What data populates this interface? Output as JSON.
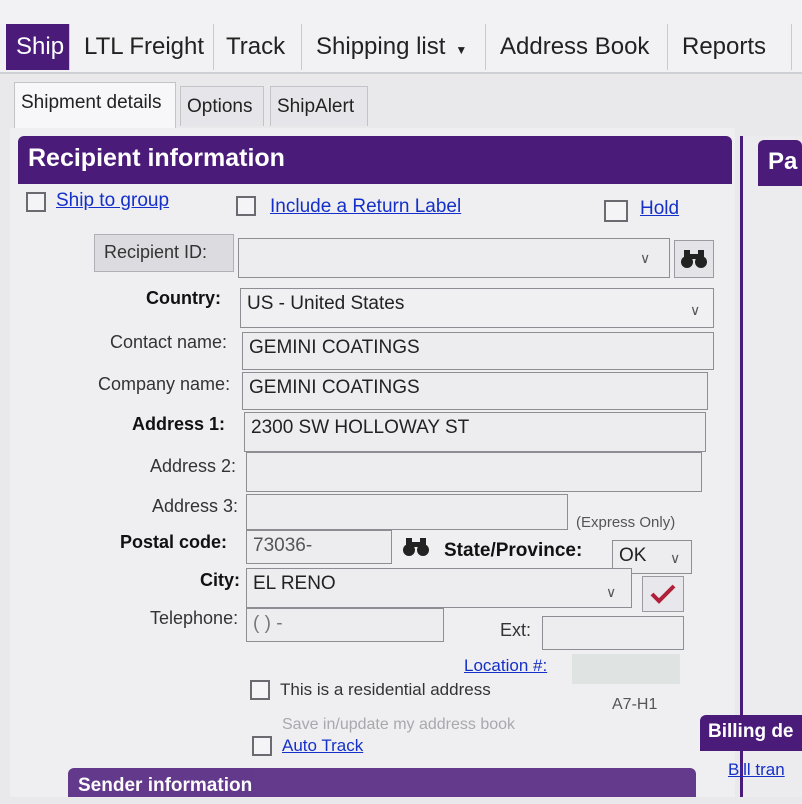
{
  "top_tabs": [
    "Ship",
    "LTL Freight",
    "Track",
    "Shipping list",
    "Address Book",
    "Reports"
  ],
  "sub_tabs": [
    "Shipment details",
    "Options",
    "ShipAlert"
  ],
  "recipient": {
    "header": "Recipient information",
    "ship_to_group": "Ship to group",
    "include_return_label": "Include a Return Label",
    "hold": "Hold",
    "recipient_id_label": "Recipient ID:",
    "recipient_id_value": "",
    "country_label": "Country:",
    "country_value": "US - United States",
    "contact_label": "Contact name:",
    "contact_value": "GEMINI COATINGS",
    "company_label": "Company name:",
    "company_value": "GEMINI COATINGS",
    "address1_label": "Address 1:",
    "address1_value": "2300 SW HOLLOWAY ST",
    "address2_label": "Address 2:",
    "address2_value": "",
    "address3_label": "Address 3:",
    "address3_value": "",
    "express_only": "(Express Only)",
    "postal_label": "Postal code:",
    "postal_value": "73036-",
    "state_label": "State/Province:",
    "state_value": "OK",
    "city_label": "City:",
    "city_value": "EL RENO",
    "telephone_label": "Telephone:",
    "telephone_value": "(   )   -",
    "ext_label": "Ext:",
    "ext_value": "",
    "location_link": "Location #:",
    "residential": "This is a residential address",
    "code": "A7-H1",
    "save_address": "Save in/update my address book",
    "auto_track": "Auto Track"
  },
  "sender_header": "Sender information",
  "right_panel": {
    "header_partial": "Pa",
    "billing_partial": "Billing de",
    "bill_link_partial": "Bill tran"
  },
  "icons": {
    "binoculars": "binoculars-icon",
    "check": "checkmark-icon",
    "dropdown": "chevron-down-icon"
  },
  "colors": {
    "accent": "#4b1b7a",
    "link": "#1530c8"
  }
}
